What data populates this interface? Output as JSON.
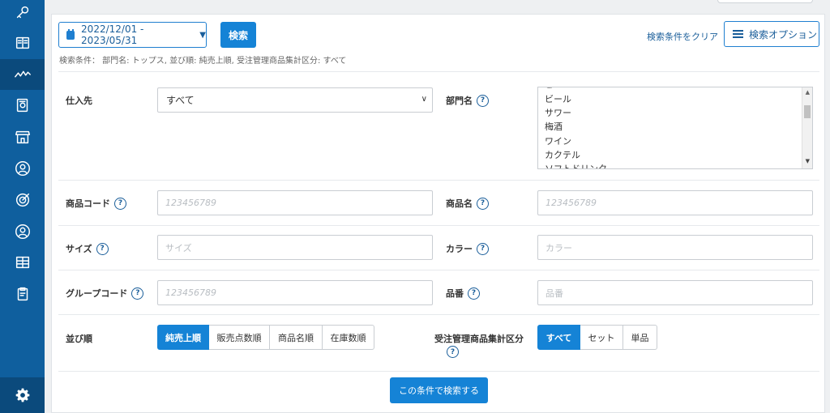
{
  "sidebar": {
    "items": [
      {
        "icon": "key-icon"
      },
      {
        "icon": "book-icon"
      },
      {
        "icon": "analytics-icon"
      },
      {
        "icon": "report-icon"
      },
      {
        "icon": "store-icon"
      },
      {
        "icon": "customer-icon"
      },
      {
        "icon": "target-icon"
      },
      {
        "icon": "user-icon"
      },
      {
        "icon": "grid-icon"
      },
      {
        "icon": "clipboard-icon"
      }
    ],
    "settings_icon": "gear-icon"
  },
  "toolbar": {
    "date_range": "2022/12/01 - 2023/05/31",
    "search_label": "検索",
    "clear_label": "検索条件をクリア",
    "options_label": "検索オプション"
  },
  "conditions": "検索条件： 部門名: トップス, 並び順: 純売上順, 受注管理商品集計区分: すべて",
  "form": {
    "supplier": {
      "label": "仕入先",
      "value": "すべて"
    },
    "department": {
      "label": "部門名",
      "options": [
        "ビール",
        "サワー",
        "梅酒",
        "ワイン",
        "カクテル",
        "ソフトドリンク"
      ]
    },
    "product_code": {
      "label": "商品コード",
      "placeholder": "123456789"
    },
    "product_name": {
      "label": "商品名",
      "placeholder": "123456789"
    },
    "size": {
      "label": "サイズ",
      "placeholder": "サイズ"
    },
    "color": {
      "label": "カラー",
      "placeholder": "カラー"
    },
    "group_code": {
      "label": "グループコード",
      "placeholder": "123456789"
    },
    "item_number": {
      "label": "品番",
      "placeholder": "品番"
    },
    "sort": {
      "label": "並び順",
      "options": [
        "純売上順",
        "販売点数順",
        "商品名順",
        "在庫数順"
      ],
      "selected": "純売上順"
    },
    "aggregation": {
      "label": "受注管理商品集計区分",
      "options": [
        "すべて",
        "セット",
        "単品"
      ],
      "selected": "すべて"
    },
    "help_mark": "?"
  },
  "submit_label": "この条件で検索する",
  "colors": {
    "sidebar": "#0f5f9e",
    "primary": "#1583d6",
    "link": "#1a5e9a"
  }
}
